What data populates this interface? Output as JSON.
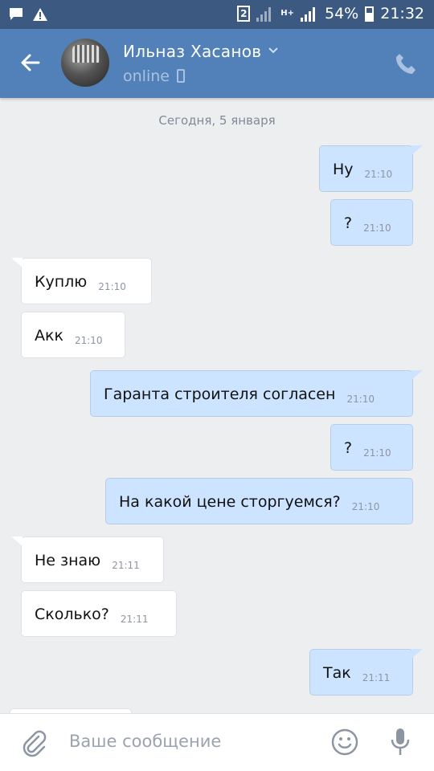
{
  "status_bar": {
    "sim": "2",
    "network": "H+",
    "battery": "54%",
    "time": "21:32"
  },
  "header": {
    "name": "Ильназ Хасанов",
    "status": "online"
  },
  "chat": {
    "date": "Сегодня, 5 января",
    "messages": [
      {
        "dir": "out",
        "text": "Ну",
        "time": "21:10"
      },
      {
        "dir": "out",
        "text": "?",
        "time": "21:10"
      },
      {
        "dir": "in",
        "text": "Куплю",
        "time": "21:10"
      },
      {
        "dir": "in",
        "text": "Акк",
        "time": "21:10"
      },
      {
        "dir": "out",
        "text": "Гаранта строителя согласен",
        "time": "21:10"
      },
      {
        "dir": "out",
        "text": "?",
        "time": "21:10"
      },
      {
        "dir": "out",
        "text": "На какой цене сторгуемся?",
        "time": "21:10"
      },
      {
        "dir": "in",
        "text": "Не знаю",
        "time": "21:11"
      },
      {
        "dir": "in",
        "text": "Сколько?",
        "time": "21:11"
      },
      {
        "dir": "out",
        "text": "Так",
        "time": "21:11"
      },
      {
        "dir": "in",
        "text": "",
        "time": ""
      }
    ]
  },
  "composer": {
    "placeholder": "Ваше сообщение"
  }
}
